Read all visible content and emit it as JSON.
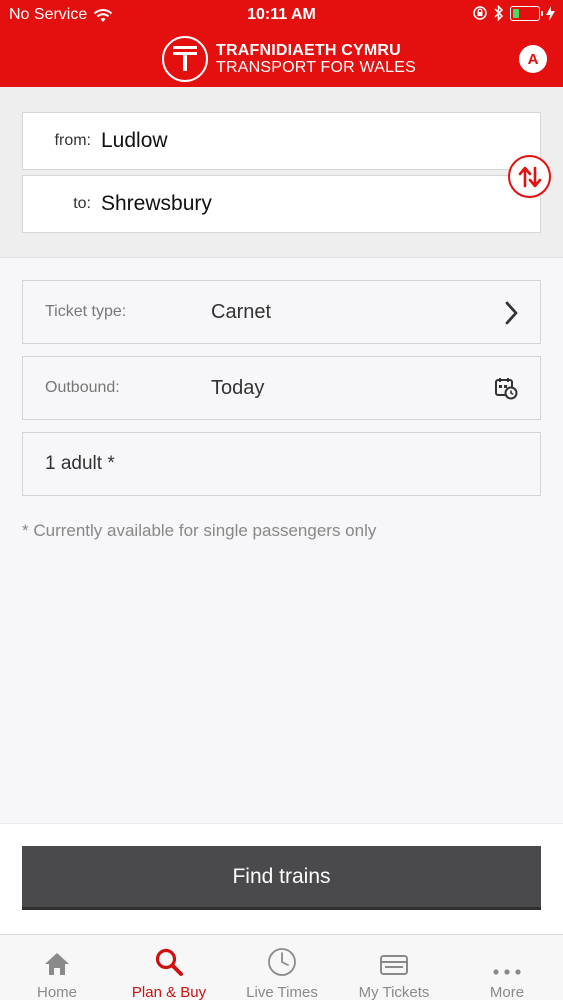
{
  "status_bar": {
    "carrier": "No Service",
    "time": "10:11 AM"
  },
  "header": {
    "brand_line1": "TRAFNIDIAETH CYMRU",
    "brand_line2": "TRANSPORT FOR WALES",
    "account_initial": "A",
    "accent_color": "#e4100f"
  },
  "journey": {
    "from_label": "from:",
    "from_value": "Ludlow",
    "to_label": "to:",
    "to_value": "Shrewsbury"
  },
  "options": {
    "ticket_type_label": "Ticket type:",
    "ticket_type_value": "Carnet",
    "outbound_label": "Outbound:",
    "outbound_value": "Today",
    "passengers_value": "1 adult *"
  },
  "note": "* Currently available for single passengers only",
  "find_button_label": "Find trains",
  "tabs": [
    {
      "label": "Home",
      "icon": "home-icon"
    },
    {
      "label": "Plan & Buy",
      "icon": "search-icon"
    },
    {
      "label": "Live Times",
      "icon": "clock-icon"
    },
    {
      "label": "My Tickets",
      "icon": "ticket-icon"
    },
    {
      "label": "More",
      "icon": "more-icon"
    }
  ]
}
